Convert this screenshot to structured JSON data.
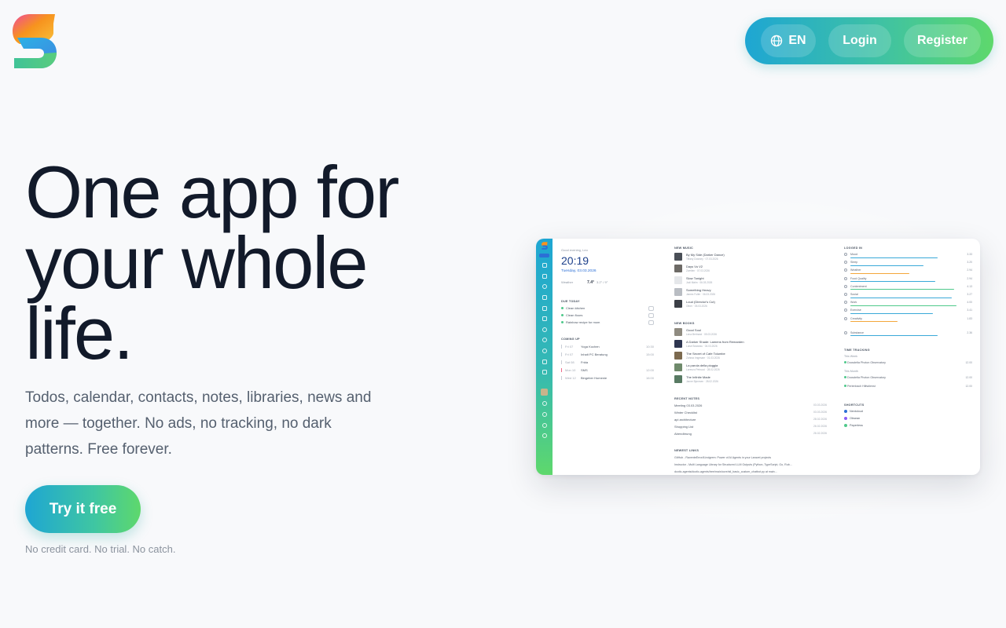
{
  "header": {
    "logo_icon": "s-logo-icon",
    "language": {
      "icon": "globe-icon",
      "label": "EN"
    },
    "login_label": "Login",
    "register_label": "Register",
    "accent_gradient": [
      "#1ea6d3",
      "#5ed86c"
    ]
  },
  "hero": {
    "title_lines": [
      "One app for",
      "your whole",
      "life."
    ],
    "subtitle": "Todos, calendar, contacts, notes, libraries, news and more — together. No ads, no tracking, no dark patterns. Free forever.",
    "cta_label": "Try it free",
    "cta_note": "No credit card. No trial. No catch."
  },
  "preview": {
    "greeting": "Good evening, Leo",
    "time": "20:19",
    "date": "Tuesday, 03.03.2026",
    "weather": {
      "label": "Weather",
      "temp": "7.4°",
      "range": "3.2° / 9°"
    },
    "todos": {
      "heading": "DUE TODAY",
      "items": [
        "Clean kitchen",
        "Clean floors",
        "Rainbow recipe for mom"
      ]
    },
    "coming_up": {
      "heading": "COMING UP",
      "events": [
        {
          "day": "Fri 07",
          "title": "Yoga Kochen",
          "time": "10:30"
        },
        {
          "day": "Fri 07",
          "title": "Inhalt PC Beratung",
          "time": "15:00"
        },
        {
          "day": "Sat 08",
          "title": "Frida",
          "time": ""
        },
        {
          "day": "Mon 10",
          "title": "SMS",
          "time": "12:00"
        },
        {
          "day": "Wed 12",
          "title": "Bingeber Homenie",
          "time": "16:00"
        }
      ]
    },
    "music": {
      "heading": "NEW MUSIC",
      "items": [
        {
          "title": "By My Side (Darker Dance)",
          "meta": "Tiffany Downey · 07.03.2026"
        },
        {
          "title": "Days Vu V2",
          "meta": "Zweiten · 07.03.2026"
        },
        {
          "title": "Slow Tonight",
          "meta": "Judi Malm · 06.03.2026"
        },
        {
          "title": "Something Heavy",
          "meta": "James Fuller · 06.03.2026"
        },
        {
          "title": "Loud (Director's Cut)",
          "meta": "Other · 05.03.2026"
        }
      ]
    },
    "books": {
      "heading": "NEW BOOKS",
      "items": [
        {
          "title": "Good Soul",
          "meta": "Lena Bertrand · 05.03.2026"
        },
        {
          "title": "A Darker Shade: Lamens from Remarden",
          "meta": "Luise Bosseau · 04.03.2026"
        },
        {
          "title": "The Secret of Cafe Tolumbe",
          "meta": "Zahraa Imgesam · 01.03.2026"
        },
        {
          "title": "La parola della pioggia",
          "meta": "Lorenzo Petrucci · 28.02.2026"
        },
        {
          "title": "The Infinite Made",
          "meta": "Janne Bjornsen · 28.02.2026"
        }
      ]
    },
    "notes": {
      "heading": "RECENT NOTES",
      "items": [
        {
          "title": "Meeting 03.03.2026",
          "date": "03.03.2026"
        },
        {
          "title": "Winter Checklist",
          "date": "03.03.2026"
        },
        {
          "title": "api architecture",
          "date": "28.02.2026"
        },
        {
          "title": "Shopping List",
          "date": "26.02.2026"
        },
        {
          "title": "Abendbrung",
          "date": "26.02.2026"
        }
      ]
    },
    "links": {
      "heading": "NEWEST LINKS",
      "items": [
        "GitHub - RaventeErrorl/Lindgrem: Power of AI Agents in your Laravel projects",
        "Instructor - Multi Language Library for Structured LLM Outputs (Python, TypeScript, Go, Rub...",
        "dcotic-agents/dcotic-agents/tree/main/core/stl_basic_custom_chatbot.py at main..."
      ]
    },
    "logged": {
      "heading": "LOGGED IN",
      "stats": [
        {
          "label": "Mood",
          "value": "3.33",
          "fill": 0.74,
          "color": "#3aa9d8"
        },
        {
          "label": "Sleep",
          "value": "3.20",
          "fill": 0.62,
          "color": "#3aa9d8"
        },
        {
          "label": "Weather",
          "value": "2.94",
          "fill": 0.5,
          "color": "#f3a73b"
        },
        {
          "label": "Food Quality",
          "value": "2.94",
          "fill": 0.72,
          "color": "#3aa9d8"
        },
        {
          "label": "Contentment",
          "value": "4.13",
          "fill": 0.88,
          "color": "#4fc98b"
        },
        {
          "label": "Social",
          "value": "3.27",
          "fill": 0.86,
          "color": "#3aa9d8"
        },
        {
          "label": "Work",
          "value": "4.00",
          "fill": 0.9,
          "color": "#4fc98b"
        },
        {
          "label": "Exercise",
          "value": "3.41",
          "fill": 0.7,
          "color": "#3aa9d8"
        },
        {
          "label": "Creativity",
          "value": "1.83",
          "fill": 0.4,
          "color": "#f3a73b"
        },
        {
          "label": "Substance",
          "value": "2.36",
          "fill": 0.74,
          "color": "#3aa9d8"
        }
      ]
    },
    "time_tracking": {
      "heading": "TIME TRACKING",
      "rows": [
        {
          "group": "This Week",
          "label": "Docsdelta Photon Observatory",
          "hours": "12.00"
        },
        {
          "group": "This Month",
          "label": "Docsdelta Photon Observatory",
          "hours": "12.00"
        },
        {
          "group": "",
          "label": "Perlenbach Hilfsdienst",
          "hours": "12.00"
        }
      ]
    },
    "shortcuts": {
      "heading": "SHORTCUTS",
      "items": [
        {
          "label": "Nextcloud",
          "color": "#2b6fd6"
        },
        {
          "label": "Obsean",
          "color": "#8b5cf6"
        },
        {
          "label": "Paperless",
          "color": "#4fc98b"
        }
      ]
    }
  }
}
